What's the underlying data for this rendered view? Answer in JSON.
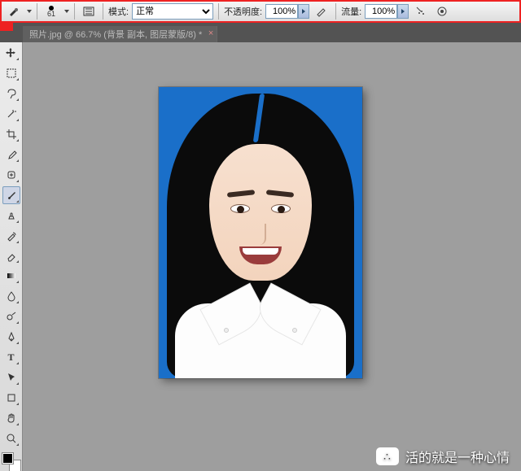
{
  "options": {
    "brush_size": "61",
    "mode_label": "模式:",
    "mode_value": "正常",
    "opacity_label": "不透明度:",
    "opacity_value": "100%",
    "flow_label": "流量:",
    "flow_value": "100%"
  },
  "document": {
    "tab_title": "照片.jpg @ 66.7% (背景 副本, 图层蒙版/8) *"
  },
  "tools": [
    "move",
    "rect-marquee",
    "lasso",
    "magic-wand",
    "crop",
    "eyedropper",
    "healing-brush",
    "brush",
    "clone-stamp",
    "history-brush",
    "eraser",
    "gradient",
    "blur",
    "dodge",
    "pen",
    "type",
    "path-select",
    "rectangle",
    "hand",
    "zoom"
  ],
  "selected_tool": "brush",
  "swatches": {
    "fg": "#000000",
    "bg": "#ffffff"
  },
  "watermark": {
    "text": "活的就是一种心情"
  }
}
